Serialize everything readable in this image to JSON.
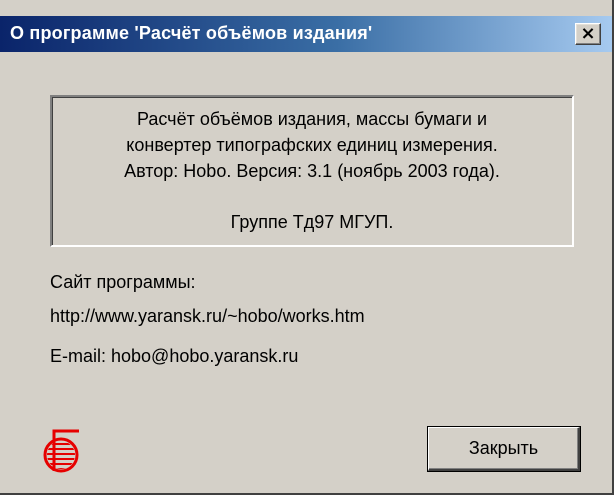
{
  "window": {
    "title": "О программе 'Расчёт объёмов издания'",
    "close_glyph": "×"
  },
  "info": {
    "line1": "Расчёт объёмов издания, массы бумаги и",
    "line2": "конвертер типографских единиц измерения.",
    "line3": "Автор: Hobo. Версия: 3.1 (ноябрь 2003 года).",
    "line4": "Группе Тд97 МГУП."
  },
  "site": {
    "label": "Сайт программы:",
    "url": "http://www.yaransk.ru/~hobo/works.htm"
  },
  "email": {
    "text": "E-mail:   hobo@hobo.yaransk.ru"
  },
  "buttons": {
    "close_label": "Закрыть"
  },
  "icons": {
    "logo": "red-publisher-logo-icon",
    "close": "close-x-icon"
  },
  "colors": {
    "titlebar_start": "#0a246a",
    "titlebar_end": "#a6caf0",
    "dialog_face": "#d4d0c8",
    "logo_red": "#e60000"
  }
}
